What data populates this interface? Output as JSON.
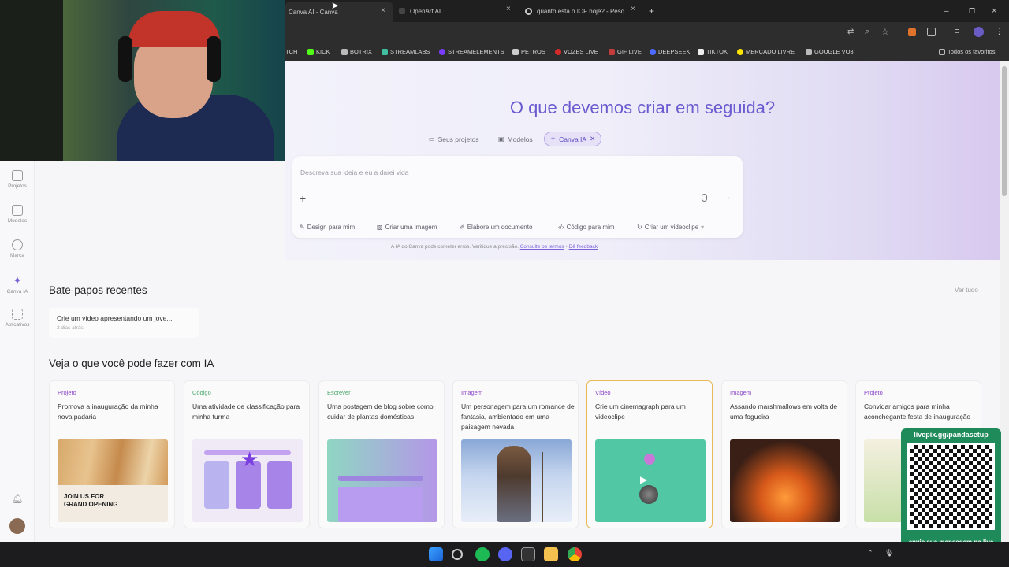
{
  "browser": {
    "tabs": [
      {
        "title": "Canva AI - Canva",
        "active": true
      },
      {
        "title": "OpenArt AI",
        "active": false
      },
      {
        "title": "quanto esta o IOF hoje? - Pesq",
        "active": false
      }
    ],
    "new_tab_symbol": "+",
    "bookmarks": [
      "TCH",
      "KICK",
      "BOTRIX",
      "STREAMLABS",
      "STREAMELEMENTS",
      "PETROS",
      "VOZES LIVE",
      "GIF LIVE",
      "DEEPSEEK",
      "TIKTOK",
      "MERCADO LIVRE",
      "GOOGLE VO3"
    ],
    "all_bookmarks": "Todos os favoritos"
  },
  "sidebar": {
    "items": [
      {
        "label": "Projetos",
        "icon": "folder-icon"
      },
      {
        "label": "Modelos",
        "icon": "template-icon"
      },
      {
        "label": "Marca",
        "icon": "brand-icon"
      },
      {
        "label": "Canva IA",
        "icon": "sparkle-icon"
      },
      {
        "label": "Aplicativos",
        "icon": "apps-icon"
      }
    ]
  },
  "hero": {
    "headline": "O que devemos criar em seguida?",
    "pills": [
      "Seus projetos",
      "Modelos",
      "Canva IA"
    ]
  },
  "prompt": {
    "placeholder": "Descreva sua ideia e eu a darei vida",
    "chips": [
      "Design para mim",
      "Criar uma imagem",
      "Elabore um documento",
      "Código para mim",
      "Criar um videoclipe"
    ],
    "disclaimer": "A IA do Canva pode cometer erros. Verifique a precisão.",
    "terms_link": "Consulte os termos",
    "feedback_link": "Dê feedback"
  },
  "recent": {
    "title": "Bate-papos recentes",
    "see_all": "Ver tudo",
    "chat_title": "Crie um vídeo apresentando um jove...",
    "chat_time": "2 dias atrás"
  },
  "ideas": {
    "title": "Veja o que você pode fazer com IA",
    "cards": [
      {
        "category": "Projeto",
        "description": "Promova a inauguração da minha nova padaria",
        "thumb_text": "JOIN US FOR GRAND OPENING"
      },
      {
        "category": "Código",
        "description": "Uma atividade de classificação para minha turma"
      },
      {
        "category": "Escrever",
        "description": "Uma postagem de blog sobre como cuidar de plantas domésticas"
      },
      {
        "category": "Imagem",
        "description": "Um personagem para um romance de fantasia, ambientado em uma paisagem nevada"
      },
      {
        "category": "Vídeo",
        "description": "Crie um cinemagraph para um videoclipe"
      },
      {
        "category": "Imagem",
        "description": "Assando marshmallows em volta de uma fogueira"
      },
      {
        "category": "Projeto",
        "description": "Convidar amigos para minha aconchegante festa de inauguração"
      }
    ]
  },
  "overlay": {
    "qr_url": "livepix.gg/pandasetup",
    "qr_caption": "envie sua mensagem na live via pix!"
  },
  "colors": {
    "accent": "#6a5bd0",
    "category": "#8a43c8"
  }
}
